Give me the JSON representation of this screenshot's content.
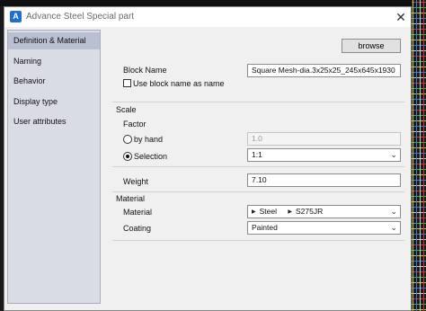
{
  "window": {
    "title": "Advance Steel   Special part",
    "app_icon": "A"
  },
  "sidebar": {
    "items": [
      {
        "label": "Definition & Material",
        "active": true
      },
      {
        "label": "Naming",
        "active": false
      },
      {
        "label": "Behavior",
        "active": false
      },
      {
        "label": "Display type",
        "active": false
      },
      {
        "label": "User attributes",
        "active": false
      }
    ]
  },
  "main": {
    "browse_label": "browse",
    "block_name_label": "Block Name",
    "block_name_value": "Square Mesh-dia.3x25x25_245x645x1930",
    "use_block_name_label": "Use block name as name",
    "use_block_name_checked": false,
    "scale": {
      "section_label": "Scale",
      "factor_label": "Factor",
      "by_hand_label": "by hand",
      "by_hand_value": "1.0",
      "selection_label": "Selection",
      "selection_value": "1:1",
      "selected_option": "selection"
    },
    "weight_label": "Weight",
    "weight_value": "7.10",
    "material": {
      "section_label": "Material",
      "material_label": "Material",
      "material_path": [
        "Steel",
        "S275JR"
      ],
      "coating_label": "Coating",
      "coating_value": "Painted"
    }
  },
  "icons": {
    "close": "close-icon",
    "chevron": "chevron-down-icon",
    "tree_arrow": "tree-arrow-icon"
  }
}
